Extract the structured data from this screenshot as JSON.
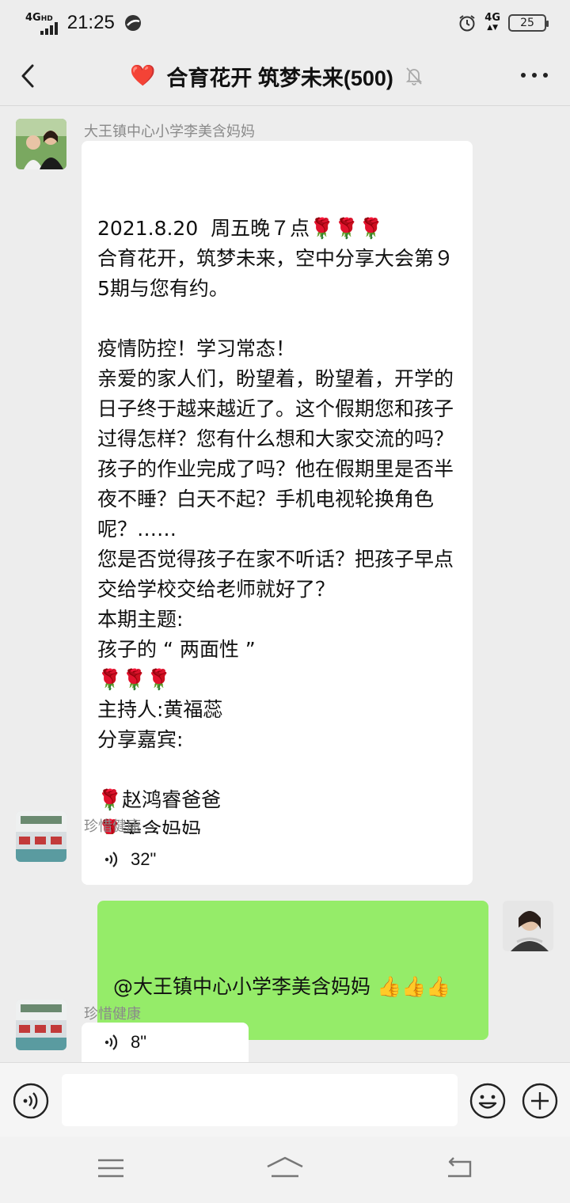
{
  "status_bar": {
    "network_left": "4G",
    "network_left_suffix": "HD",
    "time": "21:25",
    "network_right": "4G",
    "battery": "25"
  },
  "header": {
    "title": "合育花开 筑梦未来(500)",
    "heart_emoji": "❤️"
  },
  "messages": [
    {
      "sender": "大王镇中心小学李美含妈妈",
      "type": "text",
      "text": "2021.8.20  周五晚７点🌹🌹🌹\n合育花开，筑梦未来，空中分享大会第９5期与您有约。\n\n疫情防控！学习常态！\n亲爱的家人们，盼望着，盼望着，开学的日子终于越来越近了。这个假期您和孩子过得怎样？您有什么想和大家交流的吗？孩子的作业完成了吗？他在假期里是否半夜不睡？白天不起？手机电视轮换角色呢？……\n您是否觉得孩子在家不听话？把孩子早点交给学校交给老师就好了？\n本期主题:\n孩子的 “ 两面性 ”\n🌹🌹🌹\n主持人:黄福蕊\n分享嘉宾:\n\n🌹赵鸿睿爸爸\n🌹美含妈妈"
    },
    {
      "sender": "珍惜健康",
      "type": "voice",
      "duration": "32\""
    },
    {
      "sender": "",
      "type": "text",
      "mine": true,
      "text": "@大王镇中心小学李美含妈妈 👍👍👍"
    },
    {
      "sender": "珍惜健康",
      "type": "voice",
      "duration": "8\""
    }
  ],
  "input": {
    "value": "",
    "placeholder": ""
  },
  "colors": {
    "background": "#ededed",
    "bubble_incoming": "#ffffff",
    "bubble_outgoing": "#95ec69"
  }
}
